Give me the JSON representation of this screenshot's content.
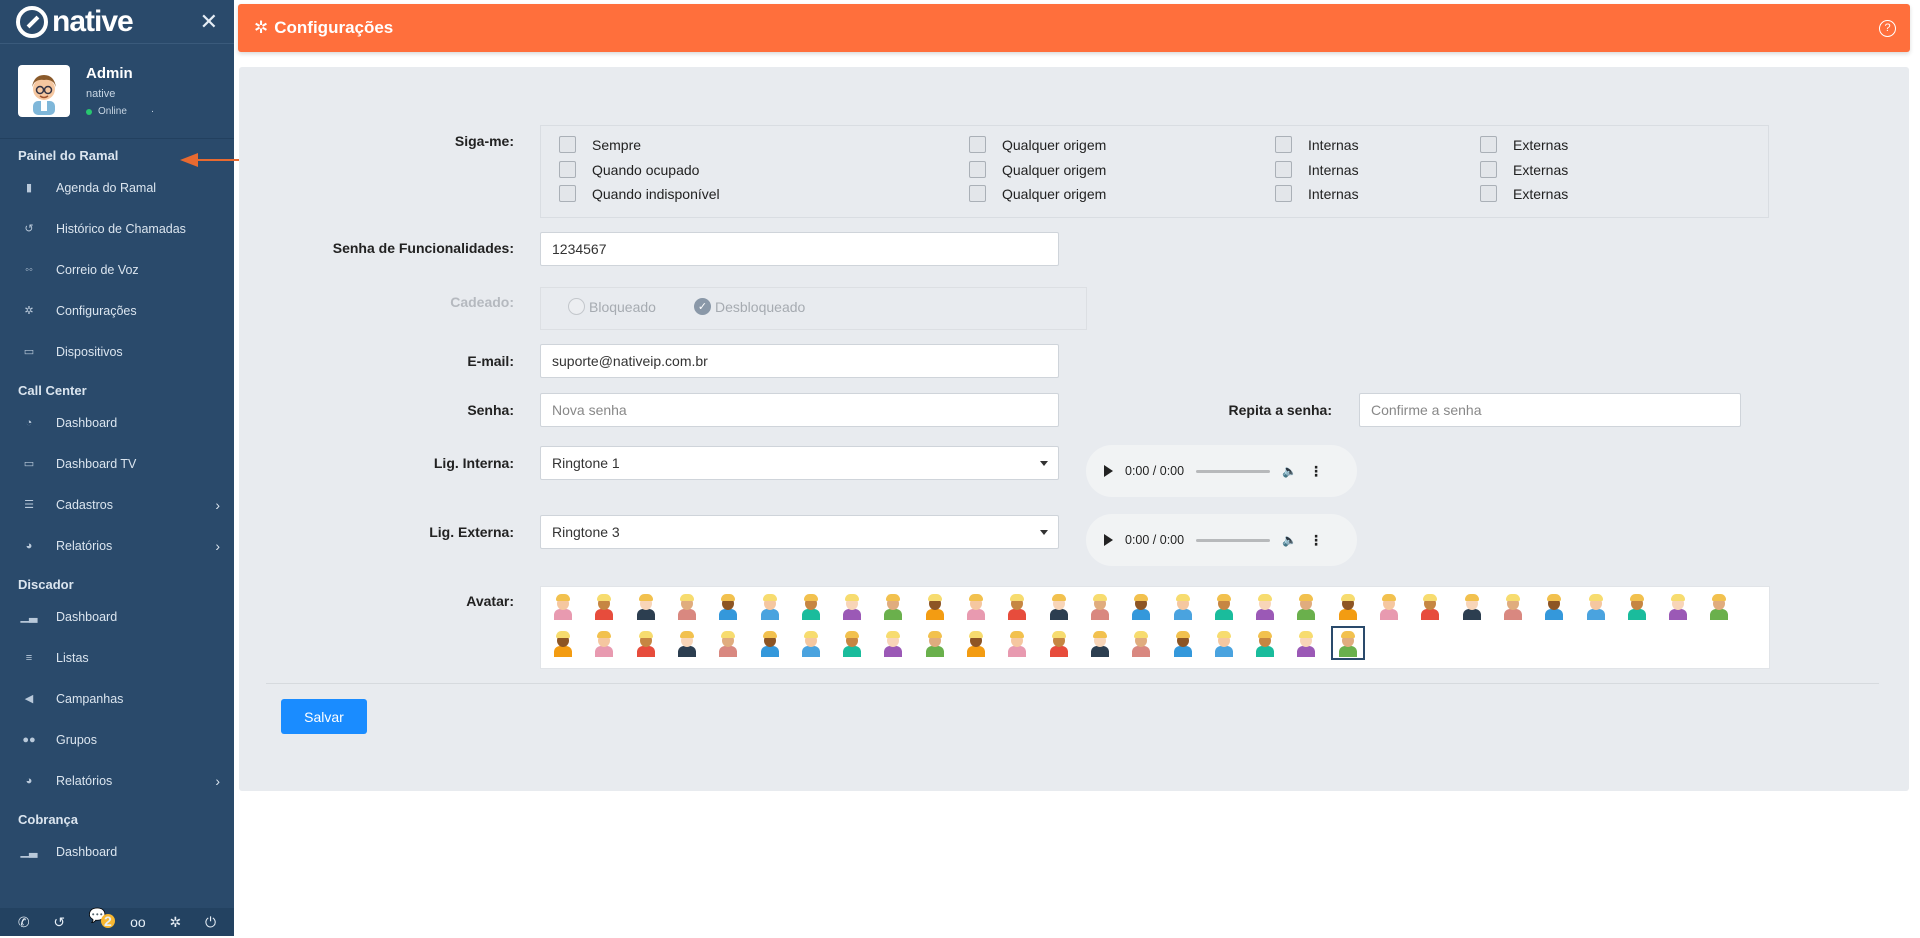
{
  "brand": {
    "name": "native"
  },
  "user": {
    "name": "Admin",
    "company": "native",
    "status": "Online"
  },
  "sidebar": {
    "sections": [
      {
        "title": "Painel do Ramal",
        "items": [
          {
            "label": "Agenda do Ramal",
            "icon": "contact-book-icon"
          },
          {
            "label": "Histórico de Chamadas",
            "icon": "history-icon"
          },
          {
            "label": "Correio de Voz",
            "icon": "voicemail-icon"
          },
          {
            "label": "Configurações",
            "icon": "gear-icon"
          },
          {
            "label": "Dispositivos",
            "icon": "monitor-icon"
          }
        ]
      },
      {
        "title": "Call Center",
        "items": [
          {
            "label": "Dashboard",
            "icon": "speedometer-icon"
          },
          {
            "label": "Dashboard TV",
            "icon": "monitor-icon"
          },
          {
            "label": "Cadastros",
            "icon": "list-icon"
          },
          {
            "label": "Relatórios",
            "icon": "pie-chart-icon"
          }
        ]
      },
      {
        "title": "Discador",
        "items": [
          {
            "label": "Dashboard",
            "icon": "bar-chart-icon"
          },
          {
            "label": "Listas",
            "icon": "list-icon"
          },
          {
            "label": "Campanhas",
            "icon": "megaphone-icon"
          },
          {
            "label": "Grupos",
            "icon": "users-icon"
          },
          {
            "label": "Relatórios",
            "icon": "pie-chart-icon"
          }
        ]
      },
      {
        "title": "Cobrança",
        "items": [
          {
            "label": "Dashboard",
            "icon": "bar-chart-icon"
          }
        ]
      }
    ],
    "bottom_badge": "2"
  },
  "header": {
    "title": "Configurações"
  },
  "form": {
    "siga_label": "Siga-me:",
    "siga_rows": [
      {
        "mode": "Sempre",
        "origin": "Qualquer origem",
        "internal": "Internas",
        "external": "Externas"
      },
      {
        "mode": "Quando ocupado",
        "origin": "Qualquer origem",
        "internal": "Internas",
        "external": "Externas"
      },
      {
        "mode": "Quando indisponível",
        "origin": "Qualquer origem",
        "internal": "Internas",
        "external": "Externas"
      }
    ],
    "senha_func_label": "Senha de Funcionalidades:",
    "senha_func_value": "1234567",
    "cadeado_label": "Cadeado:",
    "cadeado_options": [
      "Bloqueado",
      "Desbloqueado"
    ],
    "email_label": "E-mail:",
    "email_value": "suporte@nativeip.com.br",
    "senha_label": "Senha:",
    "senha_placeholder": "Nova senha",
    "repita_label": "Repita a senha:",
    "repita_placeholder": "Confirme a senha",
    "lig_interna_label": "Lig. Interna:",
    "lig_interna_value": "Ringtone 1",
    "lig_externa_label": "Lig. Externa:",
    "lig_externa_value": "Ringtone 3",
    "audio_time": "0:00 / 0:00",
    "avatar_label": "Avatar:",
    "save_label": "Salvar"
  },
  "colors": {
    "sidebar": "#2a4a6b",
    "header": "#ff6f3c",
    "primary_button": "#1a8cff",
    "online": "#28c76f"
  }
}
